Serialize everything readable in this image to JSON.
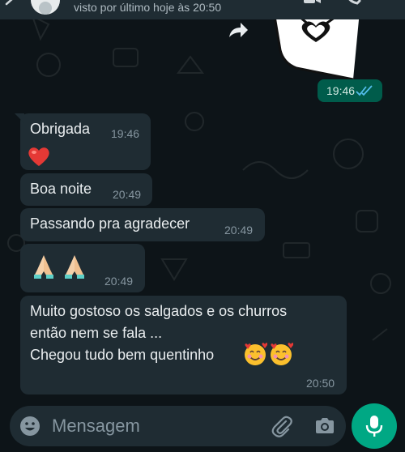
{
  "header": {
    "last_seen": "visto por último hoje às 20:50",
    "icons": [
      "back-arrow-icon",
      "avatar",
      "video-call-icon",
      "phone-icon"
    ]
  },
  "sent": {
    "sticker": "heart-sticker",
    "time": "19:46",
    "status_icon": "double-check-icon",
    "forward_icon": "forward-icon"
  },
  "messages": [
    {
      "text": "Obrigada",
      "time": "19:46",
      "emoji": "red-heart"
    },
    {
      "text": "Boa noite",
      "time": "20:49"
    },
    {
      "text": "Passando pra agradecer",
      "time": "20:49"
    },
    {
      "emoji": "folded-hands x2",
      "time": "20:49"
    },
    {
      "lines": [
        "Muito gostoso os salgados e os churros",
        "então nem se fala ...",
        "Chegou tudo bem quentinho"
      ],
      "emoji": "smiling-face-with-hearts x2",
      "time": "20:50"
    }
  ],
  "composer": {
    "placeholder": "Mensagem",
    "value": "",
    "icons": [
      "emoji-icon",
      "attach-icon",
      "camera-icon",
      "mic-icon"
    ]
  },
  "colors": {
    "background": "#0d1418",
    "incoming_bubble": "#1f2c33",
    "outgoing_bubble": "#005c4b",
    "accent": "#00a884",
    "read_ticks": "#53bdeb"
  }
}
